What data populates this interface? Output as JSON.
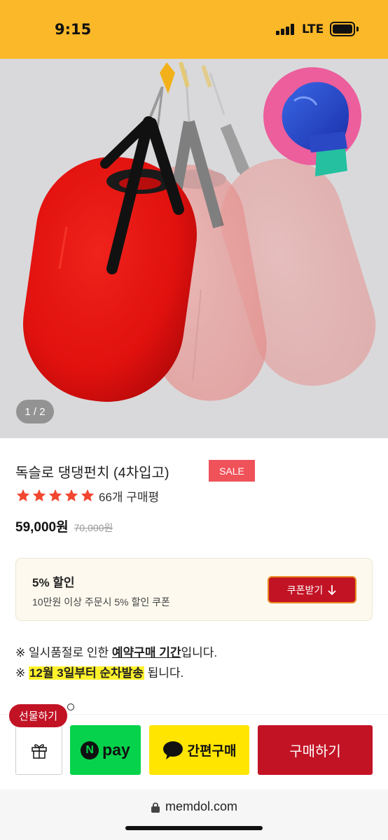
{
  "status_bar": {
    "time": "9:15",
    "network": "LTE",
    "icons": [
      "signal-icon",
      "battery-icon"
    ]
  },
  "gallery": {
    "pager": "1 / 2"
  },
  "product": {
    "title": "독슬로 댕댕펀치 (4차입고)",
    "sale_badge": "SALE",
    "rating": 5,
    "review_count": "66개 구매평",
    "price": "59,000원",
    "original_price": "70,000원"
  },
  "coupon": {
    "title": "5% 할인",
    "description": "10만원 이상 주문시 5% 할인 쿠폰",
    "button_label": "쿠폰받기"
  },
  "notices": {
    "line1_prefix": "※ 일시품절로 인한 ",
    "line1_emphasis": "예약구매 기간",
    "line1_suffix": "입니다.",
    "line2_prefix": "※ ",
    "line2_highlight": "12월 3일부터 순차발송",
    "line2_suffix": " 됩니다."
  },
  "actions": {
    "gift_tooltip": "선물하기",
    "npay_label": "pay",
    "npay_badge": "N",
    "kakao_label": "간편구매",
    "buy_label": "구매하기"
  },
  "browser": {
    "url": "memdol.com"
  },
  "colors": {
    "status_bar": "#fbb829",
    "brand_red": "#c21325",
    "sale_badge": "#f0525a",
    "star": "#f2462f",
    "npay_green": "#06d34b",
    "kakao_yellow": "#ffe500",
    "highlight_yellow": "#fff22c"
  }
}
